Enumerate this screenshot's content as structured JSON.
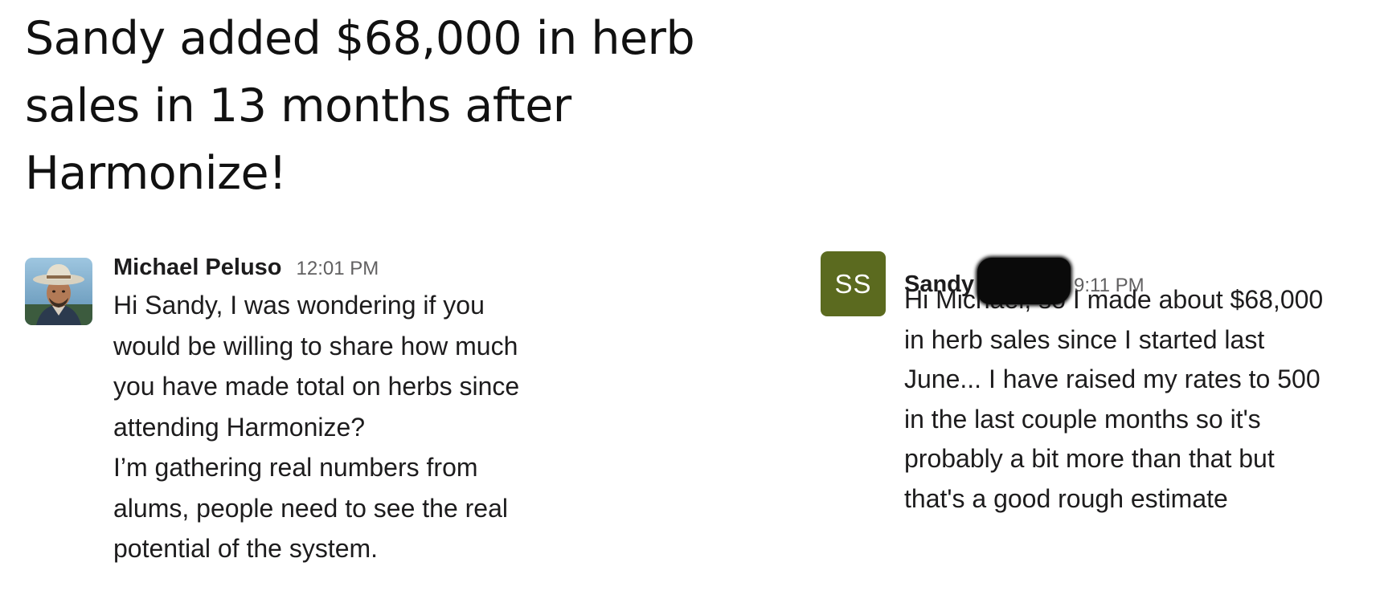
{
  "headline": "Sandy added $68,000 in herb sales in 13 months after Harmonize!",
  "messages": [
    {
      "sender": "Michael Peluso",
      "time": "12:01 PM",
      "avatar": "photo-avatar",
      "text": "Hi Sandy, I was wondering if you\nwould be willing to share how much\nyou have made total on herbs since\nattending Harmonize?\nI’m gathering real numbers from\nalums, people need to see the real\npotential of the system."
    },
    {
      "sender": "Sandy",
      "time": "9:11 PM",
      "avatar_initials": "SS",
      "avatar_color": "#5b6a1f",
      "text": "Hi Michael, so I made about $68,000\nin herb sales since I started last\nJune... I have raised my rates to 500\nin the last couple months so it's\nprobably a bit more than that but\nthat's a good rough estimate"
    }
  ]
}
